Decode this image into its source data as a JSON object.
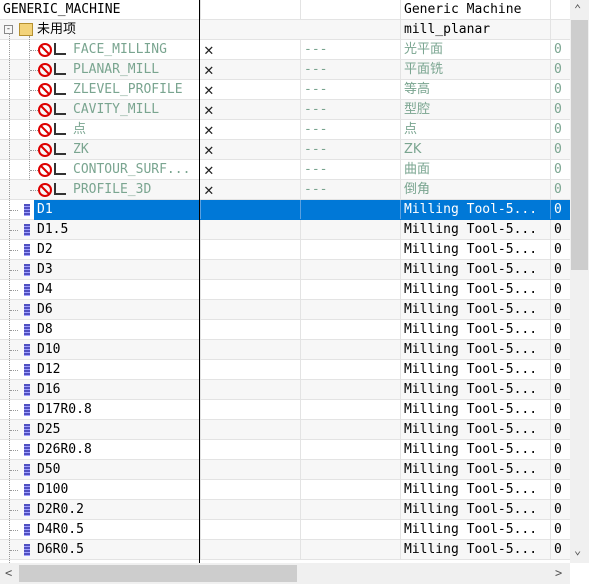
{
  "header": {
    "col1": "GENERIC_MACHINE",
    "col4": "Generic Machine"
  },
  "group": {
    "label": "未用项",
    "col4": "mill_planar"
  },
  "operations": [
    {
      "name": "FACE_MILLING",
      "path": "---",
      "desc": "光平面",
      "count": "0",
      "icon": "face-milling-icon"
    },
    {
      "name": "PLANAR_MILL",
      "path": "---",
      "desc": "平面铣",
      "count": "0",
      "icon": "planar-mill-icon"
    },
    {
      "name": "ZLEVEL_PROFILE",
      "path": "---",
      "desc": "等高",
      "count": "0",
      "icon": "zlevel-profile-icon"
    },
    {
      "name": "CAVITY_MILL",
      "path": "---",
      "desc": "型腔",
      "count": "0",
      "icon": "cavity-mill-icon"
    },
    {
      "name": "点",
      "path": "---",
      "desc": "点",
      "count": "0",
      "icon": "point-icon"
    },
    {
      "name": "ZK",
      "path": "---",
      "desc": "ZK",
      "count": "0",
      "icon": "point-icon"
    },
    {
      "name": "CONTOUR_SURF...",
      "path": "---",
      "desc": "曲面",
      "count": "0",
      "icon": "contour-surface-icon"
    },
    {
      "name": "PROFILE_3D",
      "path": "---",
      "desc": "倒角",
      "count": "0",
      "icon": "profile-3d-icon"
    }
  ],
  "tools": [
    {
      "name": "D1",
      "desc": "Milling Tool-5...",
      "count": "0",
      "selected": true
    },
    {
      "name": "D1.5",
      "desc": "Milling Tool-5...",
      "count": "0"
    },
    {
      "name": "D2",
      "desc": "Milling Tool-5...",
      "count": "0"
    },
    {
      "name": "D3",
      "desc": "Milling Tool-5...",
      "count": "0"
    },
    {
      "name": "D4",
      "desc": "Milling Tool-5...",
      "count": "0"
    },
    {
      "name": "D6",
      "desc": "Milling Tool-5...",
      "count": "0"
    },
    {
      "name": "D8",
      "desc": "Milling Tool-5...",
      "count": "0"
    },
    {
      "name": "D10",
      "desc": "Milling Tool-5...",
      "count": "0"
    },
    {
      "name": "D12",
      "desc": "Milling Tool-5...",
      "count": "0"
    },
    {
      "name": "D16",
      "desc": "Milling Tool-5...",
      "count": "0"
    },
    {
      "name": "D17R0.8",
      "desc": "Milling Tool-5...",
      "count": "0"
    },
    {
      "name": "D25",
      "desc": "Milling Tool-5...",
      "count": "0"
    },
    {
      "name": "D26R0.8",
      "desc": "Milling Tool-5...",
      "count": "0"
    },
    {
      "name": "D50",
      "desc": "Milling Tool-5...",
      "count": "0"
    },
    {
      "name": "D100",
      "desc": "Milling Tool-5...",
      "count": "0"
    },
    {
      "name": "D2R0.2",
      "desc": "Milling Tool-5...",
      "count": "0"
    },
    {
      "name": "D4R0.5",
      "desc": "Milling Tool-5...",
      "count": "0"
    },
    {
      "name": "D6R0.5",
      "desc": "Milling Tool-5...",
      "count": "0"
    }
  ],
  "colors": {
    "selection": "#0078d7",
    "disabled_text": "#7aa590",
    "no_icon": "#dd0000"
  }
}
